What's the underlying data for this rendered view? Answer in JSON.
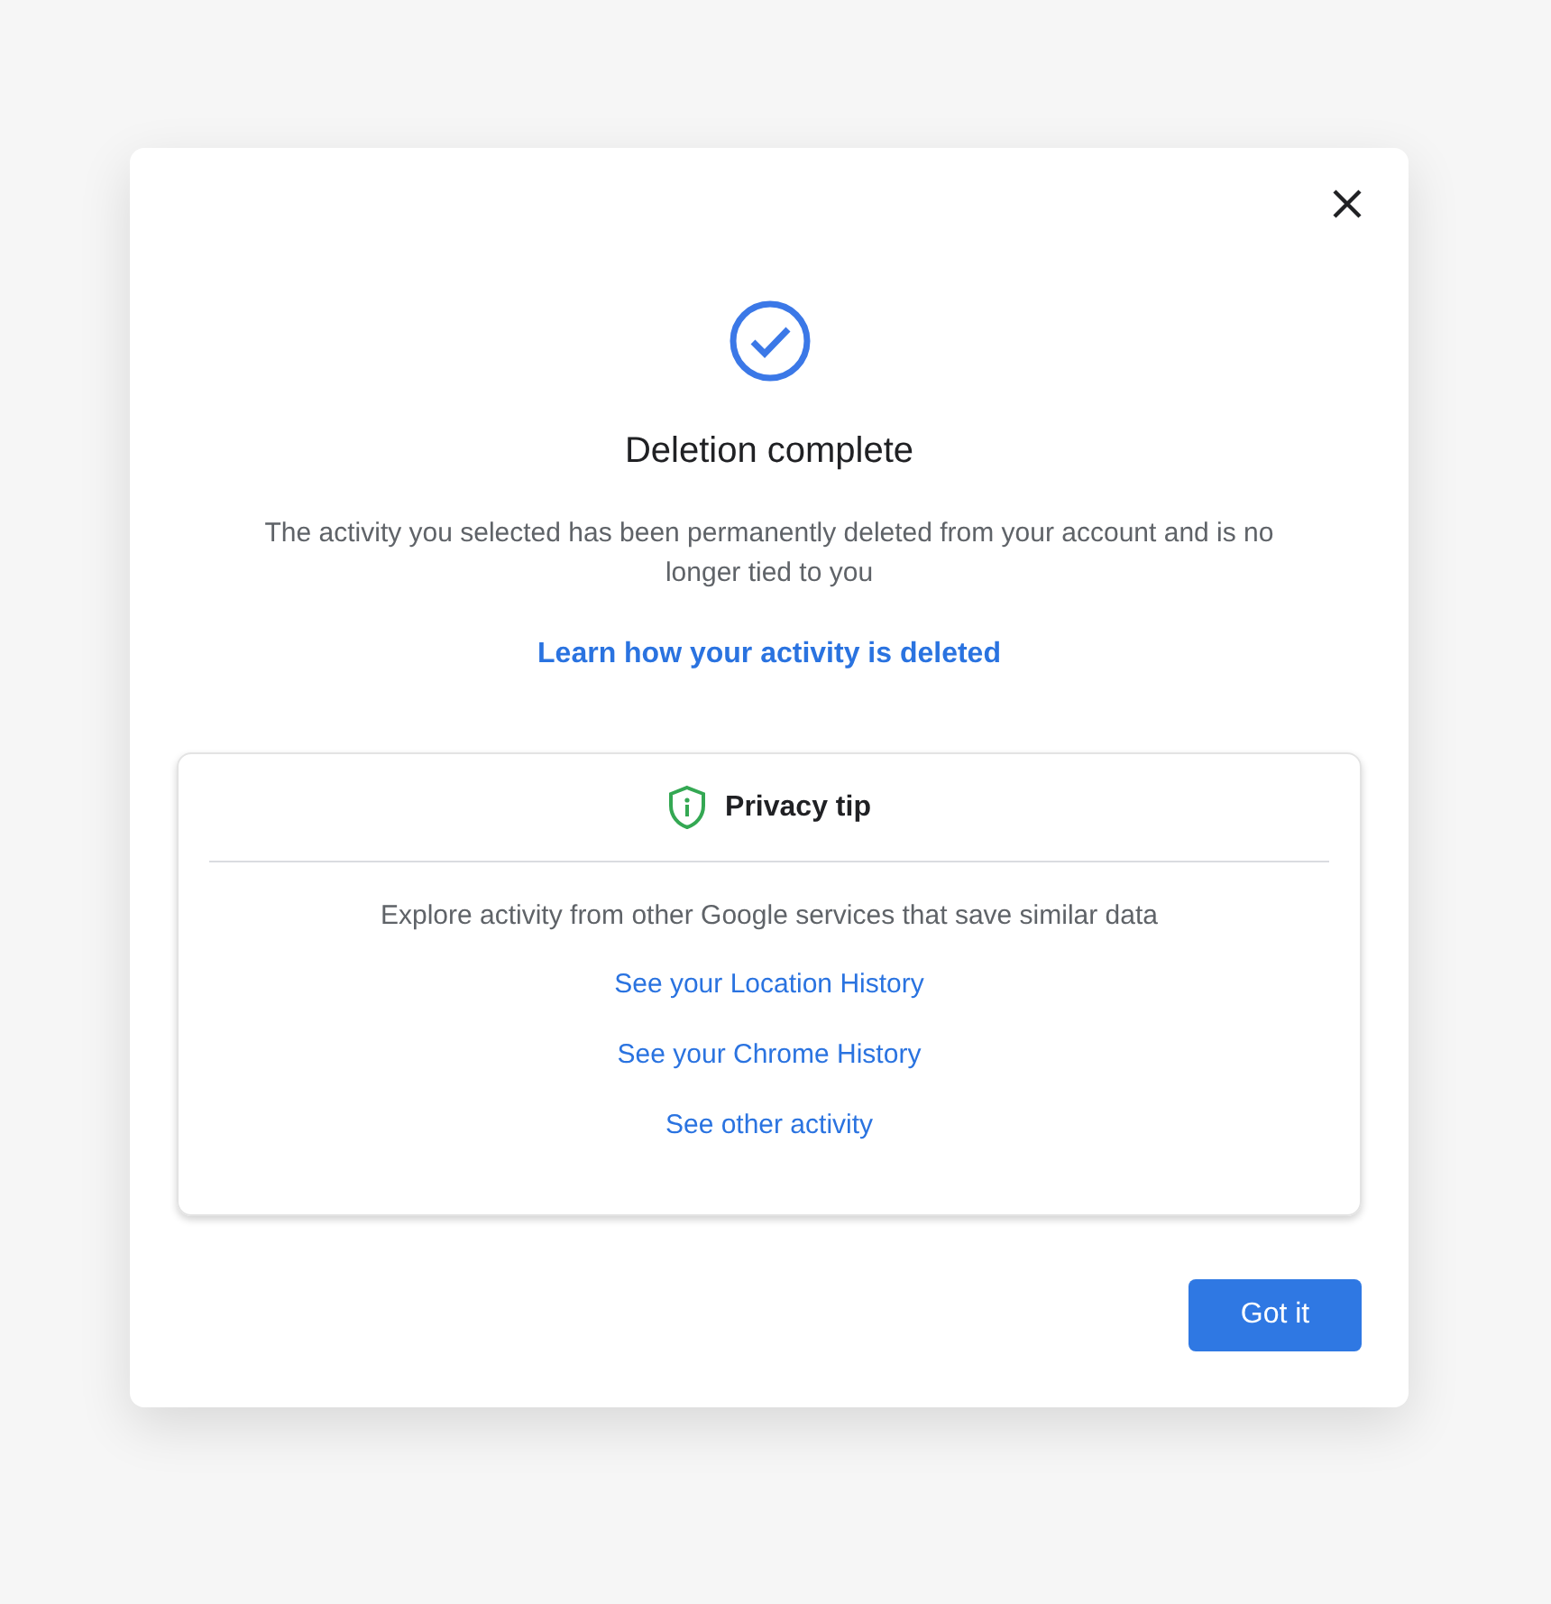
{
  "dialog": {
    "title": "Deletion complete",
    "message": "The activity you selected has been permanently deleted from your account and is no longer tied to you",
    "learn_link": "Learn how your activity is deleted",
    "privacy_tip": {
      "title": "Privacy tip",
      "message": "Explore activity from other Google services that save similar data",
      "links": [
        "See your Location History",
        "See your Chrome History",
        "See other activity"
      ]
    },
    "buttons": [
      "Got it"
    ]
  }
}
